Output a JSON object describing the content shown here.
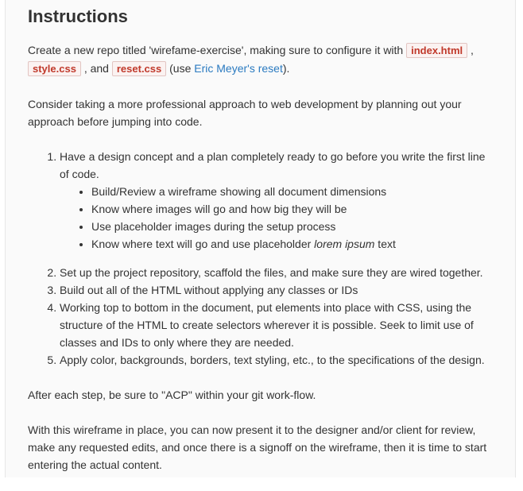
{
  "heading": "Instructions",
  "intro": {
    "part1": "Create a new repo titled 'wirefame-exercise', making sure to configure it with ",
    "code1": "index.html",
    "part2": " , ",
    "code2": "style.css",
    "part3": " , and ",
    "code3": "reset.css",
    "part4": " (use ",
    "link_text": "Eric Meyer's reset",
    "part5": ")."
  },
  "paragraph2": "Consider taking a more professional approach to web development by planning out your approach before jumping into code.",
  "steps": {
    "step1": "Have a design concept and a plan completely ready to go before you write the first line of code.",
    "bullets": {
      "b1": "Build/Review a wireframe showing all document dimensions",
      "b2": "Know where images will go and how big they will be",
      "b3": "Use placeholder images during the setup process",
      "b4_pre": "Know where text will go and use placeholder ",
      "b4_em": "lorem ipsum",
      "b4_post": " text"
    },
    "step2": "Set up the project repository, scaffold the files, and make sure they are wired together.",
    "step3": "Build out all of the HTML without applying any classes or IDs",
    "step4": "Working top to bottom in the document, put elements into place with CSS, using the structure of the HTML to create selectors wherever it is possible. Seek to limit use of classes and IDs to only where they are needed.",
    "step5": "Apply color, backgrounds, borders, text styling, etc., to the specifications of the design."
  },
  "paragraph3": "After each step, be sure to \"ACP\" within your git work-flow.",
  "paragraph4": "With this wireframe in place, you can now present it to the designer and/or client for review, make any requested edits, and once there is a signoff on the wireframe, then it is time to start entering the actual content."
}
